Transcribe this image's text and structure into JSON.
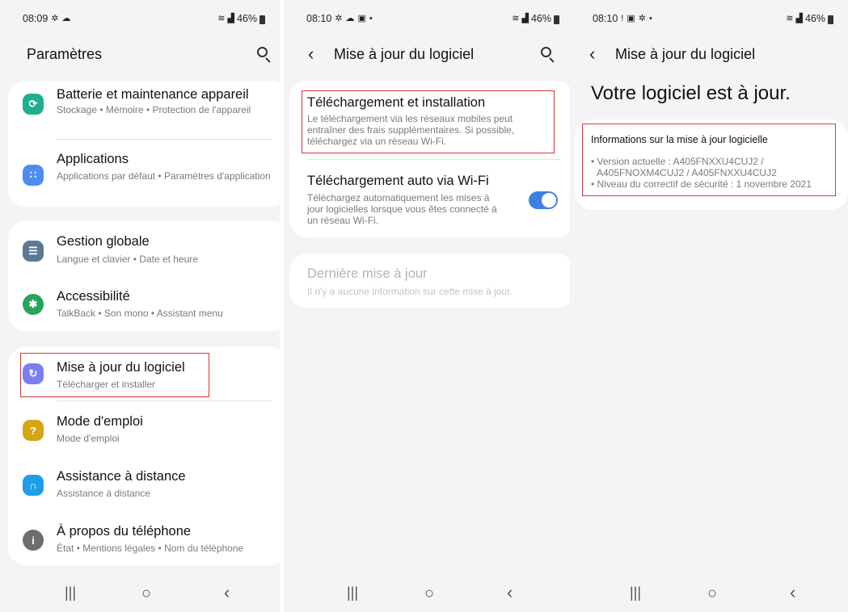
{
  "screen1": {
    "status": {
      "time": "08:09",
      "battery": "46%"
    },
    "header": {
      "title": "Paramètres"
    },
    "groups": [
      {
        "items": [
          {
            "title": "Batterie et maintenance appareil",
            "subtitle": "Stockage • Mémoire • Protection de l'appareil",
            "icon": "device-care-icon",
            "color": "#1fae8e"
          },
          {
            "title": "Applications",
            "subtitle": "Applications par défaut • Paramètres d'application",
            "icon": "apps-icon",
            "color": "#4b8ef0"
          }
        ]
      },
      {
        "items": [
          {
            "title": "Gestion globale",
            "subtitle": "Langue et clavier • Date et heure",
            "icon": "general-management-icon",
            "color": "#5b7896"
          },
          {
            "title": "Accessibilité",
            "subtitle": "TalkBack • Son mono • Assistant menu",
            "icon": "accessibility-icon",
            "color": "#27a35a"
          }
        ]
      },
      {
        "items": [
          {
            "title": "Mise à jour du logiciel",
            "subtitle": "Télécharger et installer",
            "icon": "software-update-icon",
            "color": "#7b7ef0"
          },
          {
            "title": "Mode d'emploi",
            "subtitle": "Mode d'emploi",
            "icon": "user-manual-icon",
            "color": "#d4a514"
          },
          {
            "title": "Assistance à distance",
            "subtitle": "Assistance à distance",
            "icon": "remote-support-icon",
            "color": "#1f9ee8"
          },
          {
            "title": "À propos du téléphone",
            "subtitle": "État • Mentions légales • Nom du téléphone",
            "icon": "about-phone-icon",
            "color": "#6d6d6d"
          }
        ]
      }
    ]
  },
  "screen2": {
    "status": {
      "time": "08:10",
      "battery": "46%"
    },
    "header": {
      "title": "Mise à jour du logiciel"
    },
    "items": [
      {
        "title": "Téléchargement et installation",
        "subtitle": "Le téléchargement via les réseaux mobiles peut entraîner des frais supplémentaires. Si possible, téléchargez via un réseau Wi-Fi."
      },
      {
        "title": "Téléchargement auto via Wi-Fi",
        "subtitle": "Téléchargez automatiquement les mises à jour logicielles lorsque vous êtes connecté à un réseau Wi-Fi.",
        "toggle_on": true
      },
      {
        "title": "Dernière mise à jour",
        "subtitle": "Il n'y a aucune information sur cette mise à jour."
      }
    ]
  },
  "screen3": {
    "status": {
      "time": "08:10",
      "battery": "46%"
    },
    "header": {
      "title": "Mise à jour du logiciel"
    },
    "headline": "Votre logiciel est à jour.",
    "info": {
      "title": "Informations sur la mise à jour logicielle",
      "version_line1": "• Version actuelle : A405FNXXU4CUJ2 /",
      "version_line2": "A405FNOXM4CUJ2 / A405FNXXU4CUJ2",
      "security_line": "• Niveau du correctif de sécurité : 1 novembre 2021"
    }
  },
  "nav": {
    "recents": "|||",
    "home": "○",
    "back": "‹"
  },
  "colors": {
    "background": "#f4f4f4",
    "card": "#ffffff",
    "accent": "#3e7fe6",
    "highlight": "#d9363e"
  }
}
